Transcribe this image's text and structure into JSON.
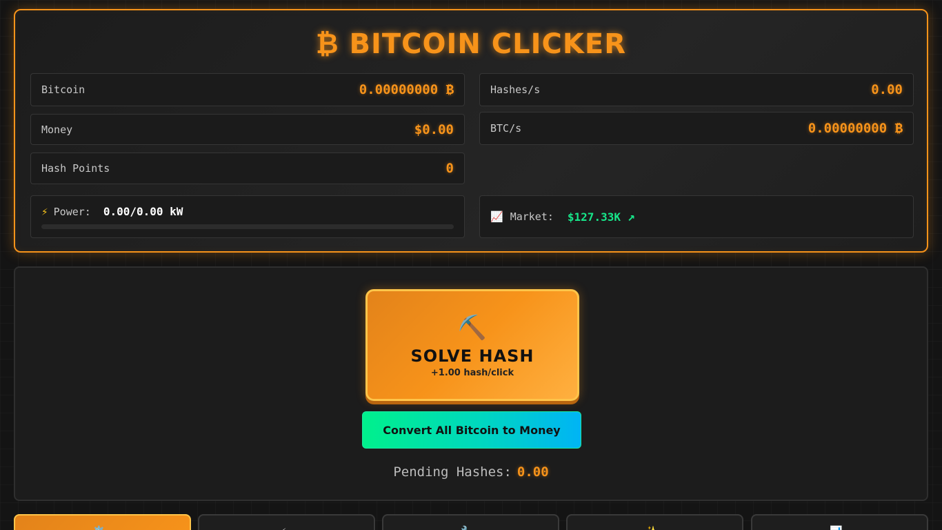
{
  "title": "₿ BITCOIN CLICKER",
  "stats": {
    "bitcoin": {
      "label": "Bitcoin",
      "value": "0.00000000 ₿"
    },
    "hashes_per_sec": {
      "label": "Hashes/s",
      "value": "0.00"
    },
    "money": {
      "label": "Money",
      "value": "$0.00"
    },
    "btc_per_sec": {
      "label": "BTC/s",
      "value": "0.00000000 ₿"
    },
    "hash_points": {
      "label": "Hash Points",
      "value": "0"
    }
  },
  "power": {
    "icon": "⚡",
    "label": "Power:",
    "value": "0.00/0.00 kW",
    "fill_percent": 0
  },
  "market": {
    "icon": "📈",
    "label": "Market:",
    "value": "$127.33K",
    "trend": "↗"
  },
  "mining": {
    "icon": "⛏️",
    "solve_label": "SOLVE HASH",
    "per_click": "+1.00 hash/click",
    "convert_label": "Convert All Bitcoin to Money",
    "pending_label": "Pending Hashes:",
    "pending_value": "0.00"
  },
  "tabs": [
    {
      "icon": "⚙️",
      "label": "",
      "active": true
    },
    {
      "icon": "⚡",
      "label": "",
      "active": false
    },
    {
      "icon": "🔧",
      "label": "",
      "active": false
    },
    {
      "icon": "✨",
      "label": "",
      "active": false
    },
    {
      "icon": "📊",
      "label": "",
      "active": false
    }
  ],
  "colors": {
    "accent": "#f7931a",
    "success": "#17e68a",
    "panel": "#1b1b1b"
  }
}
